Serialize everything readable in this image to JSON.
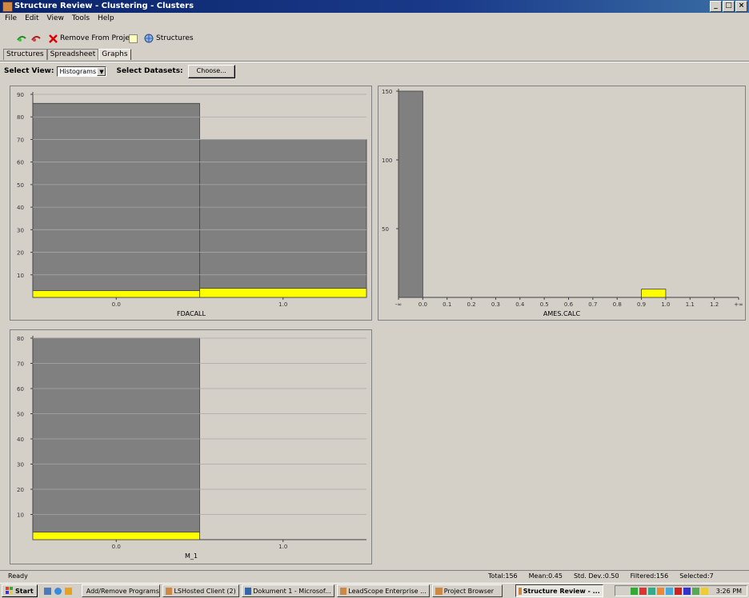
{
  "window": {
    "title": "Structure Review - Clustering - Clusters"
  },
  "menu": [
    "File",
    "Edit",
    "View",
    "Tools",
    "Help"
  ],
  "toolbar": {
    "remove_label": "Remove From Project",
    "structures_label": "Structures"
  },
  "tabs": [
    "Structures",
    "Spreadsheet",
    "Graphs"
  ],
  "controls": {
    "view_label": "Select View:",
    "view_value": "Histograms",
    "datasets_label": "Select Datasets:",
    "choose_label": "Choose..."
  },
  "colors": {
    "bar_gray": "#808080",
    "bar_yellow": "#ffff00",
    "plot_bg": "#d4d0c8",
    "gridline": "#a9a9a9"
  },
  "chart_data": [
    {
      "type": "bar",
      "title": "",
      "xlabel": "FDACALL",
      "ylabel": "",
      "categories": [
        "0.0",
        "1.0"
      ],
      "series": [
        {
          "color": "gray",
          "values": [
            86,
            70
          ]
        },
        {
          "color": "yellow",
          "values": [
            3,
            4
          ]
        }
      ],
      "yticks": [
        10,
        20,
        30,
        40,
        50,
        60,
        70,
        80,
        90
      ],
      "ylim": [
        0,
        90
      ],
      "grid": true
    },
    {
      "type": "bar",
      "title": "",
      "xlabel": "AMES.CALC",
      "ylabel": "",
      "categories": [
        "-∞",
        "0.0",
        "0.1",
        "0.2",
        "0.3",
        "0.4",
        "0.5",
        "0.6",
        "0.7",
        "0.8",
        "0.9",
        "1.0",
        "1.1",
        "1.2",
        "+∞"
      ],
      "bins": [
        {
          "from": "-∞",
          "to": "0.0",
          "color": "gray",
          "value": 150
        },
        {
          "from": "0.9",
          "to": "1.0",
          "color": "yellow",
          "value": 6
        }
      ],
      "yticks": [
        50,
        100,
        150
      ],
      "ylim": [
        0,
        150
      ],
      "grid": true
    },
    {
      "type": "bar",
      "title": "",
      "xlabel": "M_1",
      "ylabel": "",
      "categories": [
        "0.0",
        "1.0"
      ],
      "series": [
        {
          "color": "gray",
          "values": [
            80,
            0
          ]
        },
        {
          "color": "yellow",
          "values": [
            3,
            0
          ]
        }
      ],
      "yticks": [
        10,
        20,
        30,
        40,
        50,
        60,
        70,
        80
      ],
      "ylim": [
        0,
        80
      ],
      "grid": true
    }
  ],
  "status": {
    "ready": "Ready",
    "total": "Total:156",
    "mean": "Mean:0.45",
    "std": "Std. Dev.:0.50",
    "filtered": "Filtered:156",
    "selected": "Selected:7"
  },
  "taskbar": {
    "start": "Start",
    "tasks": [
      "Add/Remove Programs",
      "LSHosted Client (2)",
      "Dokument 1 - Microsof...",
      "LeadScope Enterprise ...",
      "Project Browser",
      "Structure Review - ..."
    ],
    "clock": "3:26 PM"
  }
}
